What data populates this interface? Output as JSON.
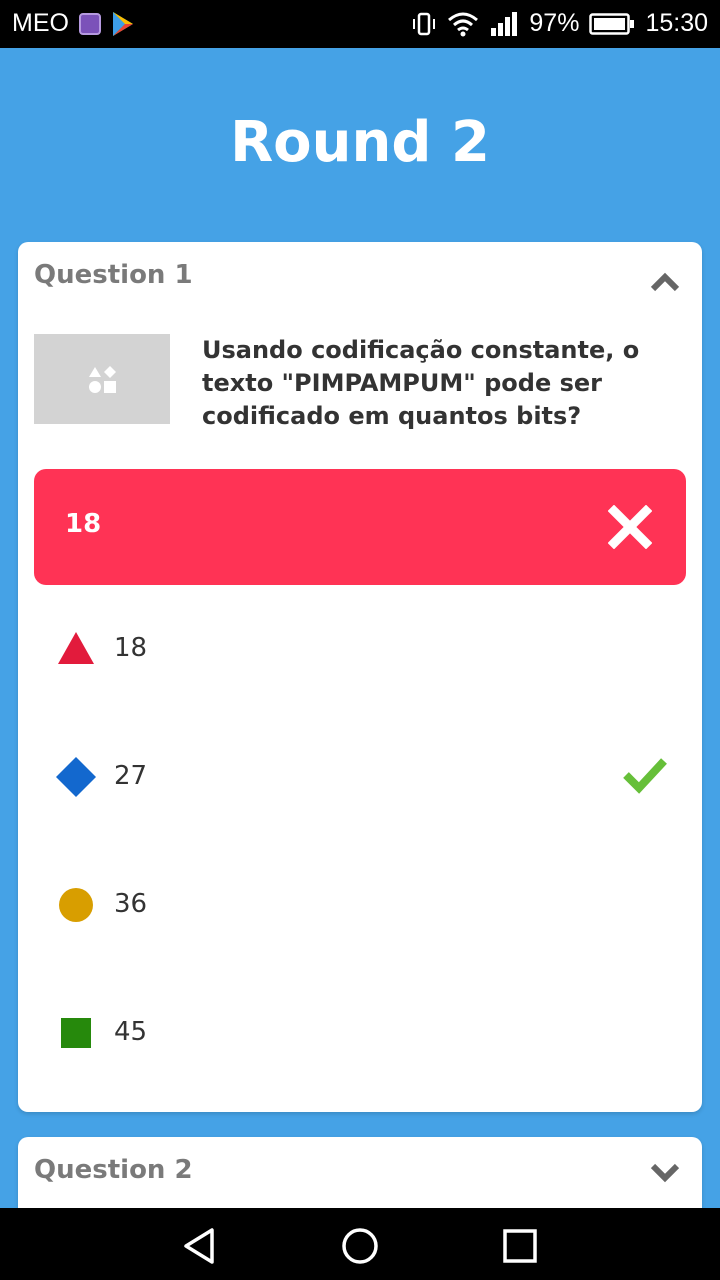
{
  "status_bar": {
    "carrier": "MEO",
    "battery": "97%",
    "time": "15:30",
    "icons": [
      "gallery-icon",
      "play-store-icon",
      "vibrate-icon",
      "wifi-icon",
      "signal-icon",
      "battery-icon"
    ]
  },
  "round": {
    "title": "Round 2"
  },
  "question1": {
    "header": "Question 1",
    "expanded": true,
    "text": "Usando codificação constante, o texto \"PIMPAMPUM\" pode ser codificado em quantos bits?",
    "selected_answer": "18",
    "selected_correct": false,
    "options": [
      {
        "label": "18",
        "shape": "triangle",
        "color": "#e21b3c",
        "correct": false
      },
      {
        "label": "27",
        "shape": "diamond",
        "color": "#1368ce",
        "correct": true
      },
      {
        "label": "36",
        "shape": "circle",
        "color": "#d89e00",
        "correct": false
      },
      {
        "label": "45",
        "shape": "square",
        "color": "#26890c",
        "correct": false
      }
    ]
  },
  "question2": {
    "header": "Question 2",
    "expanded": false
  },
  "colors": {
    "background": "#45a2e6",
    "wrong": "#ff3355",
    "check": "#66bf39"
  }
}
